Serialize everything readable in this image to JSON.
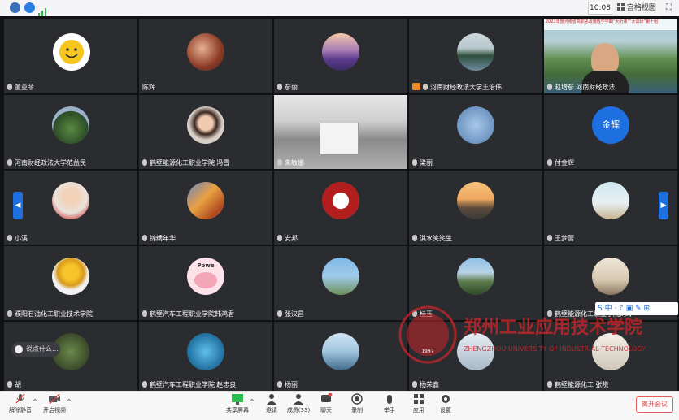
{
  "topbar": {
    "time": "10:08",
    "view_label": "宫格视图"
  },
  "tiles": [
    {
      "name": "董亚菲",
      "muted": false
    },
    {
      "name": "陈辉",
      "muted": false
    },
    {
      "name": "彦丽",
      "muted": false
    },
    {
      "name": "河南财经政法大学王治伟",
      "muted": false
    },
    {
      "name": "赵增彦 河南财经政法",
      "muted": false
    },
    {
      "name": "河南财经政法大学范益民",
      "muted": false
    },
    {
      "name": "鹤壁能源化工职业学院 冯雪",
      "muted": false
    },
    {
      "name": "朱敏娜",
      "muted": false
    },
    {
      "name": "梁丽",
      "muted": false
    },
    {
      "name": "付金辉",
      "muted": false
    },
    {
      "name": "小溪",
      "muted": false
    },
    {
      "name": "锦绣年华",
      "muted": false
    },
    {
      "name": "安邦",
      "muted": false
    },
    {
      "name": "淇水笑笑生",
      "muted": false
    },
    {
      "name": "王梦蕾",
      "muted": false
    },
    {
      "name": "濮阳石油化工职业技术学院",
      "muted": false
    },
    {
      "name": "鹤壁汽车工程职业学院韩鸿君",
      "muted": false
    },
    {
      "name": "张汉昌",
      "muted": false
    },
    {
      "name": "桂玉",
      "muted": false
    },
    {
      "name": "鹤壁能源化工职业学院刘玲",
      "muted": false
    },
    {
      "name": "胡",
      "muted": false
    },
    {
      "name": "鹤壁汽车工程职业学院 赵忠良",
      "muted": false
    },
    {
      "name": "杨丽",
      "muted": false
    },
    {
      "name": "杨荣鑫",
      "muted": false
    },
    {
      "name": "鹤壁能源化工 张晓",
      "muted": false
    }
  ],
  "avatar_text": {
    "fujinhui": "金辉",
    "powe": "Powe"
  },
  "banner_text": "2022年度河南省高职思政课教学学期“大听课”“大调研”第十组",
  "chat_placeholder": "说点什么...",
  "watermark": {
    "school_cn": "郑州工业应用技术学院",
    "school_en": "ZHENGZHOU UNIVERSITY OF INDUSTRIAL TECHNOLOGY",
    "year": "1997"
  },
  "ime_label": "S 中",
  "toolbar": {
    "mute": "解除静音",
    "video": "开启视频",
    "share": "共享屏幕",
    "invite": "邀请",
    "members": "成员(33)",
    "chat": "聊天",
    "record": "录制",
    "hand": "举手",
    "apps": "应用",
    "settings": "设置",
    "leave": "离开会议"
  },
  "colors": {
    "accent": "#1e6fe0",
    "tile_bg": "#2b2c30",
    "leave_red": "#e04848",
    "watermark_red": "#c8262b"
  }
}
